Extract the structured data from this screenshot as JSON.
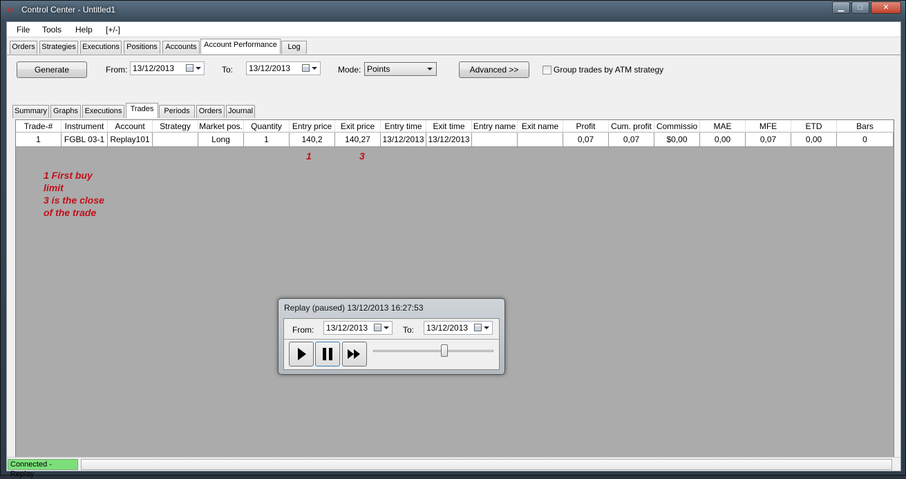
{
  "window": {
    "title": "Control Center - Untitled1",
    "minimize": "▁",
    "maximize": "□",
    "close": "✕"
  },
  "menu": [
    "File",
    "Tools",
    "Help",
    "[+/-]"
  ],
  "main_tabs": [
    "Orders",
    "Strategies",
    "Executions",
    "Positions",
    "Accounts",
    "Account Performance",
    "Log"
  ],
  "toolbar": {
    "generate": "Generate",
    "from_label": "From:",
    "from_value": "13/12/2013",
    "to_label": "To:",
    "to_value": "13/12/2013",
    "mode_label": "Mode:",
    "mode_value": "Points",
    "advanced": "Advanced >>",
    "group_trades_label": "Group trades by ATM strategy",
    "group_trades_checked": false
  },
  "sub_tabs": [
    "Summary",
    "Graphs",
    "Executions",
    "Trades",
    "Periods",
    "Orders",
    "Journal"
  ],
  "grid": {
    "columns": [
      "Trade-#",
      "Instrument",
      "Account",
      "Strategy",
      "Market pos.",
      "Quantity",
      "Entry price",
      "Exit price",
      "Entry time",
      "Exit time",
      "Entry name",
      "Exit name",
      "Profit",
      "Cum. profit",
      "Commissio",
      "MAE",
      "MFE",
      "ETD",
      "Bars"
    ],
    "rows": [
      [
        "1",
        "FGBL 03-1",
        "Replay101",
        "",
        "Long",
        "1",
        "140,2",
        "140,27",
        "13/12/2013",
        "13/12/2013",
        "",
        "",
        "0,07",
        "0,07",
        "$0,00",
        "0,00",
        "0,07",
        "0,00",
        "0"
      ]
    ]
  },
  "annotations": {
    "entry_marker": "1",
    "exit_marker": "3",
    "note_lines": [
      "1 First buy",
      "limit",
      "3 is the close",
      "of the trade"
    ]
  },
  "status": {
    "connection": "Connected - Replay"
  },
  "replay": {
    "title": "Replay (paused) 13/12/2013 16:27:53",
    "from_label": "From:",
    "from_value": "13/12/2013",
    "to_label": "To:",
    "to_value": "13/12/2013",
    "speed_fraction": 0.6
  },
  "colors": {
    "annotation": "#c0101a",
    "connected": "#7ddf7a",
    "grid_background": "#ababab"
  }
}
